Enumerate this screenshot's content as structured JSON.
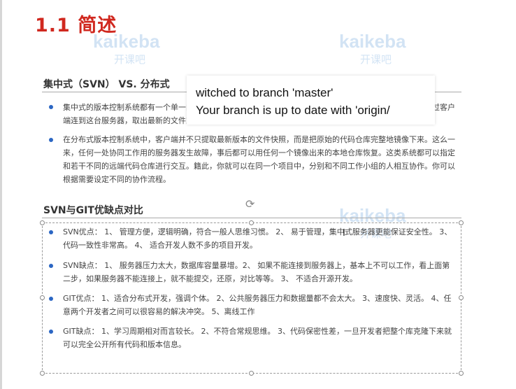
{
  "slide": {
    "title": "1.1 简述",
    "watermark_text": "kaikeba",
    "watermark_sub": "开课吧",
    "section1": {
      "header": "集中式（SVN） VS. 分布式",
      "paragraphs": [
        "集中式的版本控制系统都有一个单一的集中管理的服务器，保存所有文件的修订版本，而协同工作的人们都通过客户端连到这台服务器，取出最新的文件或者提交更新。",
        "在分布式版本控制系统中，客户端并不只提取最新版本的文件快照，而是把原始的代码仓库完整地镜像下来。这么一来，任何一处协同工作用的服务器发生故障，事后都可以用任何一个镜像出来的本地仓库恢复。这类系统都可以指定和若干不同的远端代码仓库进行交互。籍此，你就可以在同一个项目中，分别和不同工作小组的人相互协作。你可以根据需要设定不同的协作流程。"
      ]
    },
    "section2": {
      "header": "SVN与GIT优缺点对比",
      "paragraphs": [
        "SVN优点： 1、 管理方便，逻辑明确，符合一般人思维习惯。 2、 易于管理，集中式服务器更能保证安全性。 3、 代码一致性非常高。 4、 适合开发人数不多的项目开发。",
        "SVN缺点： 1、 服务器压力太大，数据库容量暴增。2、 如果不能连接到服务器上，基本上不可以工作，看上面第二步，如果服务器不能连接上，就不能提交，还原，对比等等。 3、 不适合开源开发。",
        "GIT优点： 1、适合分布式开发，强调个体。 2、公共服务器压力和数据量都不会太大。 3、速度快、灵活。 4、任意两个开发者之间可以很容易的解决冲突。 5、离线工作",
        "GIT缺点： 1、学习周期相对而言较长。 2、不符合常规思维。 3、代码保密性差，一旦开发者把整个库克隆下来就可以完全公开所有代码和版本信息。"
      ]
    }
  },
  "tooltip": {
    "line1": "witched to branch 'master'",
    "line2": "Your branch is up to date with 'origin/"
  },
  "colors": {
    "title": "#d0281f",
    "bullet": "#2b66c3",
    "watermark": "#7fb1e0"
  }
}
